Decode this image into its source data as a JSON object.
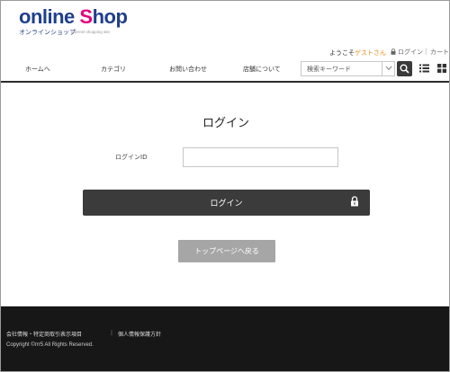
{
  "header": {
    "logo": {
      "online": "online",
      "s": "S",
      "hop": "hop",
      "sub": "オンラインショップ",
      "tagline": "Internet shopping site"
    },
    "welcome_prefix": "ようこそ",
    "welcome_guest": "ゲストさん",
    "login_link": "ログイン",
    "separator": "|",
    "cart_link": "カート",
    "nav": {
      "home": "ホームへ",
      "category": "カテゴリ",
      "contact": "お問い合わせ",
      "store": "店舗について"
    },
    "search": {
      "placeholder": "検索キーワード"
    }
  },
  "main": {
    "title": "ログイン",
    "login_id_label": "ログインID",
    "login_id_value": "",
    "login_button": "ログイン",
    "back_button": "トップページへ戻る"
  },
  "footer": {
    "company_link": "会社情報・特定商取引表示項目",
    "separator": "|",
    "privacy_link": "個人情報保護方針",
    "copyright": "Copyright ©rrr5 All Rights Reserved."
  },
  "colors": {
    "brand_blue": "#1f3f8c",
    "brand_pink": "#e6007e",
    "guest_orange": "#e58a1a",
    "dark_button": "#3b3b3b",
    "gray_button": "#a6a6a6",
    "footer_bg": "#171717"
  },
  "icons": {
    "login_lock": "lock-icon",
    "search": "search-icon",
    "dropdown": "chevron-down-icon",
    "list_view": "list-view-icon",
    "grid_view": "grid-view-icon"
  }
}
